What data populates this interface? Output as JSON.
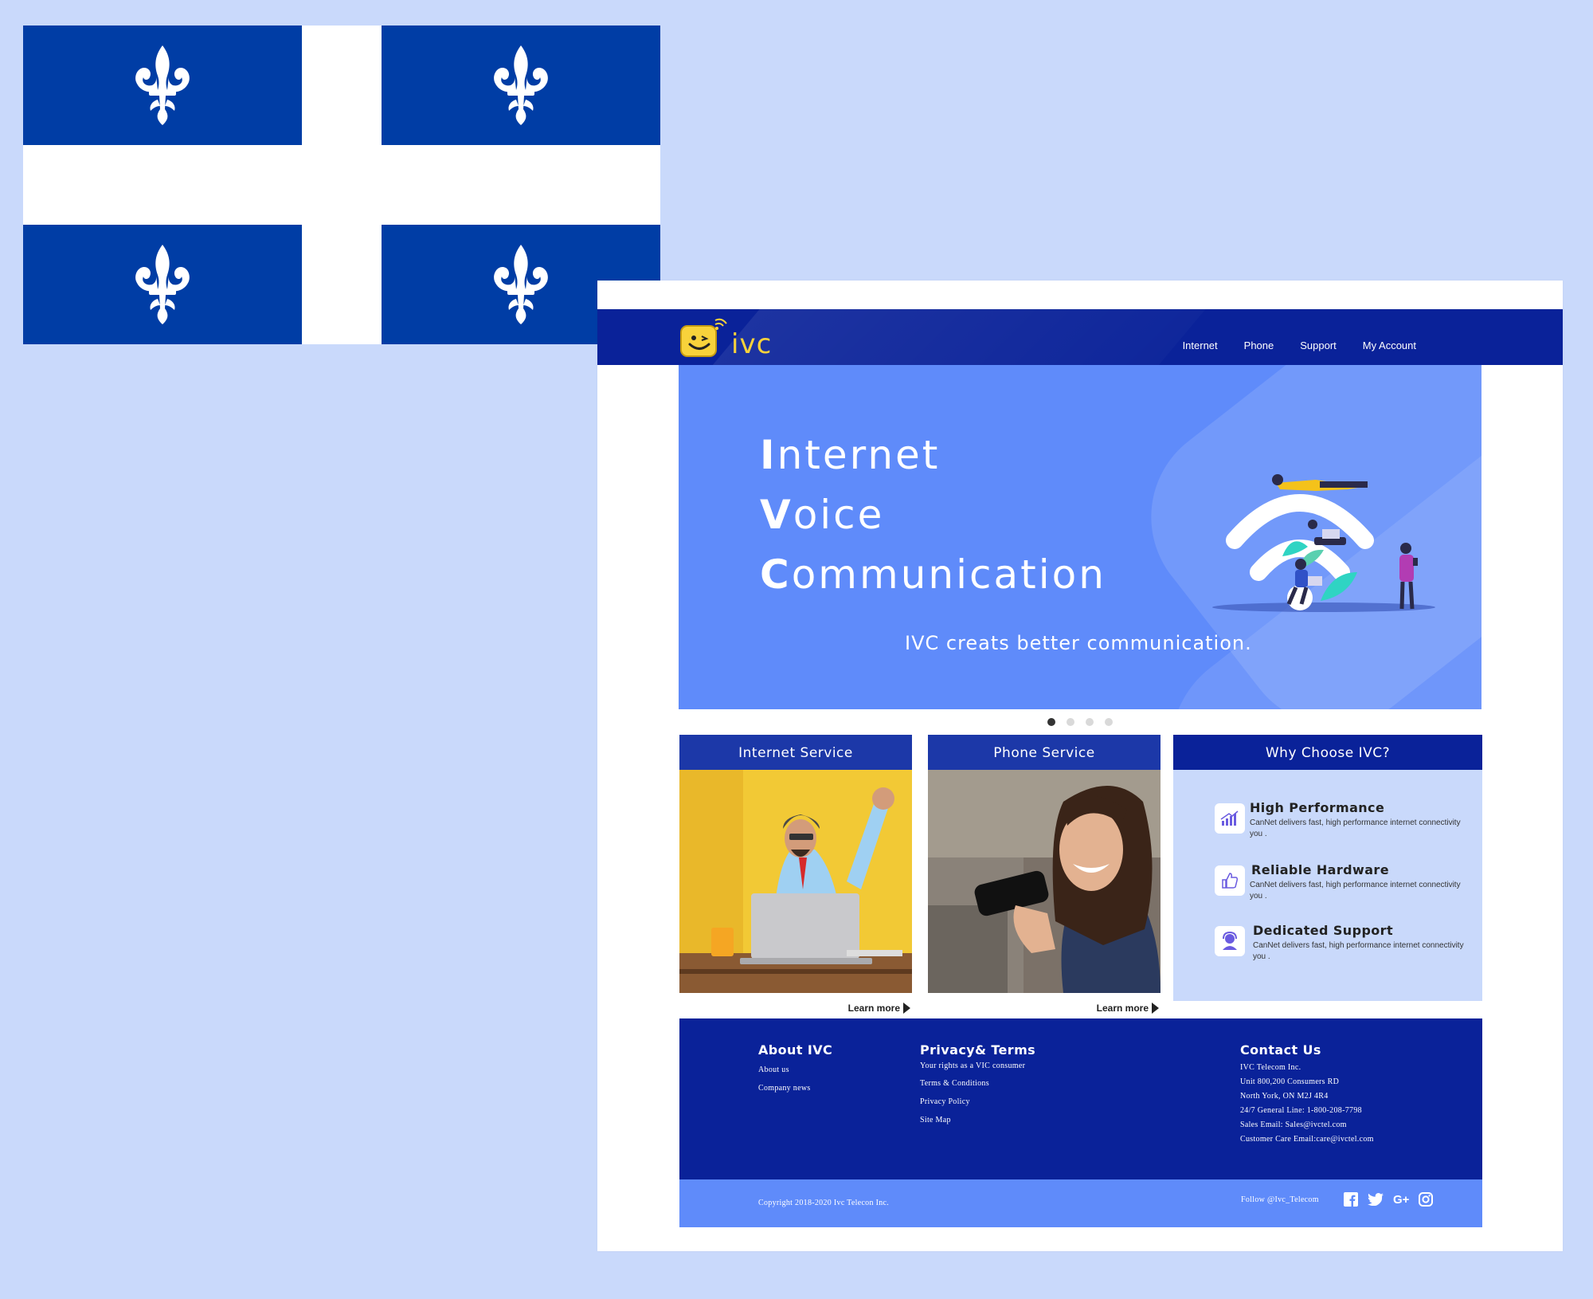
{
  "header": {
    "logo_text": "ivc",
    "nav": [
      "Internet",
      "Phone",
      "Support",
      "My Account"
    ]
  },
  "hero": {
    "line1_initial": "I",
    "line1_rest": "nternet",
    "line2_initial": "V",
    "line2_rest": "oice",
    "line3_initial": "C",
    "line3_rest": "ommunication",
    "subtitle": "IVC creats better communication.",
    "slides": 4,
    "active_slide": 1
  },
  "cards": {
    "internet": {
      "title": "Internet Service",
      "learn": "Learn more"
    },
    "phone": {
      "title": "Phone  Service",
      "learn": "Learn more"
    },
    "why": {
      "title": "Why Choose IVC?",
      "items": [
        {
          "title": "High Performance",
          "desc": "CanNet delivers fast, high performance internet connectivity you .",
          "icon": "chart-icon"
        },
        {
          "title": "Reliable Hardware",
          "desc": "CanNet delivers fast, high performance internet connectivity you .",
          "icon": "thumbs-up-icon"
        },
        {
          "title": "Dedicated Support",
          "desc": "CanNet delivers fast, high performance internet connectivity you .",
          "icon": "support-agent-icon"
        }
      ]
    }
  },
  "footer": {
    "about": {
      "title": "About IVC",
      "links": [
        "About us",
        "Company news"
      ]
    },
    "privacy": {
      "title": "Privacy& Terms",
      "links": [
        "Your rights as a VIC consumer",
        "Terms & Conditions",
        "Privacy Policy",
        "Site Map"
      ]
    },
    "contact": {
      "title": "Contact Us",
      "lines": [
        "IVC Telecom Inc.",
        "Unit 800,200 Consumers RD",
        "North York, ON M2J 4R4",
        "24/7 General Line: 1-800-208-7798",
        "Sales Email: Sales@ivctel.com",
        "Customer Care Email:care@ivctel.com"
      ]
    },
    "copyright": "Copyright 2018-2020 Ivc Telecon Inc.",
    "follow": "Follow @Ivc_Telecom",
    "social": [
      "facebook-icon",
      "twitter-icon",
      "google-plus-icon",
      "instagram-icon"
    ]
  },
  "colors": {
    "background": "#c9d9fb",
    "flag_blue": "#003da5",
    "header_blue": "#0a2299",
    "hero_blue": "#5f8bfa",
    "logo_yellow": "#f8d23b"
  }
}
